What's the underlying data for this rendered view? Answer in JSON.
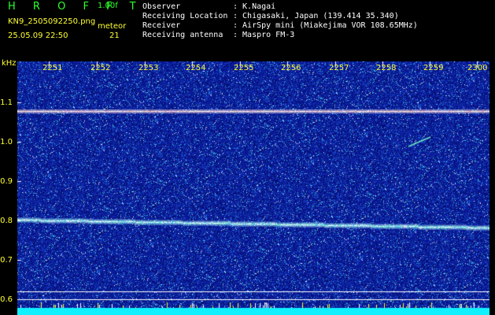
{
  "app": {
    "logo": "H R O F F T",
    "version": "1.00f"
  },
  "file": {
    "name": "KN9_2505092250.png",
    "datetime": "25.05.09 22:50"
  },
  "meteor": {
    "label": "meteor",
    "count": "21"
  },
  "info": [
    {
      "key": "Observer",
      "value": ": K.Nagai"
    },
    {
      "key": "Receiving Location",
      "value": ": Chigasaki, Japan (139.414 35.340)"
    },
    {
      "key": "Receiver",
      "value": ": AirSpy mini (Miakejima VOR 108.65MHz)"
    },
    {
      "key": "Receiving antenna",
      "value": ": Maspro FM-3"
    }
  ],
  "axes": {
    "y_unit": "kHz",
    "y_ticks": [
      "1.1",
      "1.0",
      "0.9",
      "0.8",
      "0.7",
      "0.6"
    ],
    "x_ticks": [
      "2251",
      "2252",
      "2253",
      "2254",
      "2255",
      "2256",
      "2257",
      "2258",
      "2259",
      "2300"
    ]
  },
  "colors": {
    "accent": "#2cff2c",
    "label": "#ffff33",
    "text": "#ffffff",
    "trace": "#ffffff",
    "background_noise": "#0a1aa0"
  }
}
